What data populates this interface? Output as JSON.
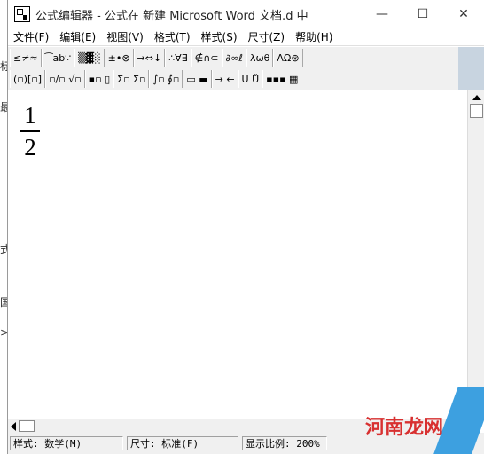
{
  "background_fragments": [
    "标",
    "最",
    "式",
    "国",
    ">"
  ],
  "window": {
    "title": "公式编辑器 - 公式在 新建 Microsoft Word 文档.d 中",
    "controls": {
      "minimize": "—",
      "maximize": "☐",
      "close": "✕"
    }
  },
  "menu": [
    "文件(F)",
    "编辑(E)",
    "视图(V)",
    "格式(T)",
    "样式(S)",
    "尺寸(Z)",
    "帮助(H)"
  ],
  "toolbar": {
    "row1": [
      "≤≠≈",
      "⁀ab∵",
      "▒▓░",
      "±•⊗",
      "→⇔↓",
      "∴∀∃",
      "∉∩⊂",
      "∂∞ℓ",
      "λωθ",
      "ΛΩ⊛"
    ],
    "row2": [
      "(▫)[▫]",
      "▫/▫ √▫",
      "▪▫ ▯",
      "Σ▫ Σ▫",
      "∫▫ ∮▫",
      "▭ ▬",
      "→ ←",
      "Ū Ů",
      "▪▪▪ ▦"
    ]
  },
  "equation": {
    "numerator": "1",
    "denominator": "2"
  },
  "status": {
    "style": "样式: 数学(M)",
    "size": "尺寸: 标准(F)",
    "zoom": "显示比例: 200%"
  },
  "watermark": "河南龙网"
}
